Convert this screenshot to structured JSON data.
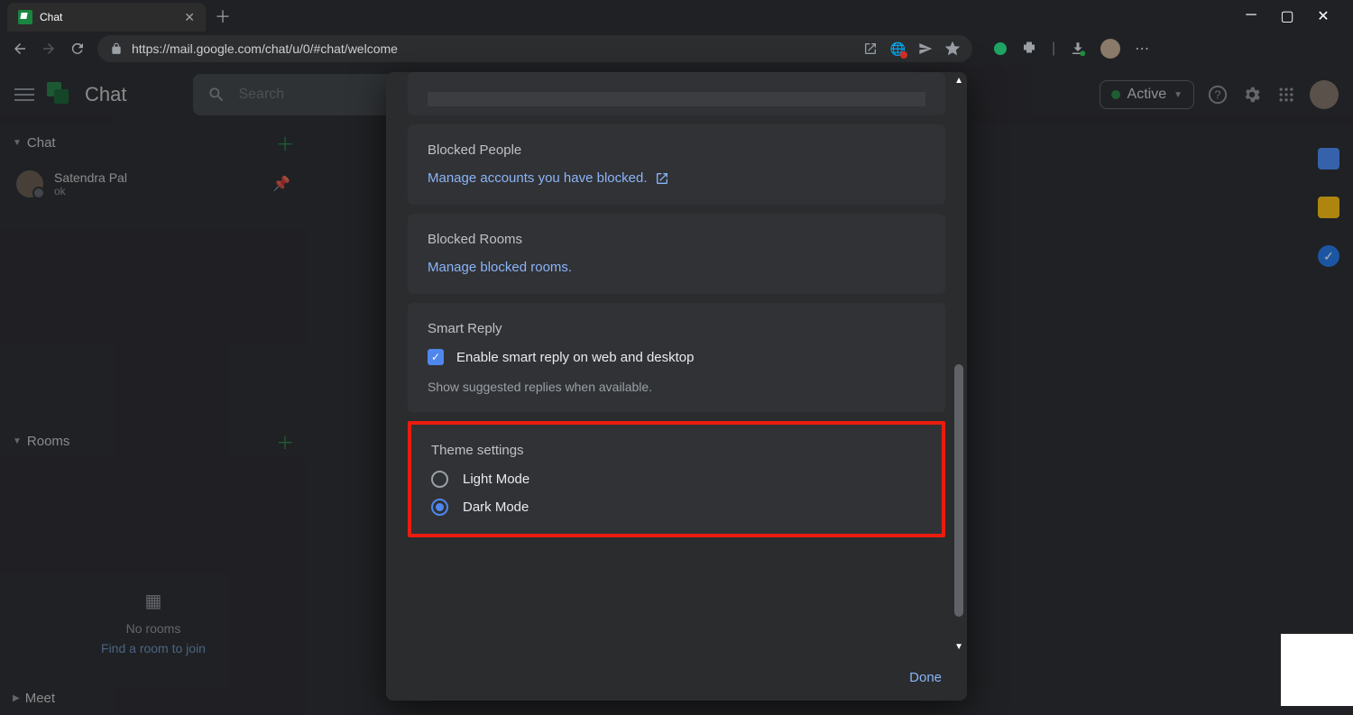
{
  "browser": {
    "tab_title": "Chat",
    "url": "https://mail.google.com/chat/u/0/#chat/welcome"
  },
  "app": {
    "title": "Chat",
    "search_placeholder": "Search",
    "status": "Active"
  },
  "sidebar": {
    "chat_section": "Chat",
    "rooms_section": "Rooms",
    "meet_section": "Meet",
    "contact": {
      "name": "Satendra Pal",
      "snippet": "ok"
    },
    "rooms_empty": {
      "title": "No rooms",
      "cta": "Find a room to join"
    }
  },
  "settings": {
    "blocked_people": {
      "title": "Blocked People",
      "link": "Manage accounts you have blocked."
    },
    "blocked_rooms": {
      "title": "Blocked Rooms",
      "link": "Manage blocked rooms."
    },
    "smart_reply": {
      "title": "Smart Reply",
      "checkbox": "Enable smart reply on web and desktop",
      "desc": "Show suggested replies when available."
    },
    "theme": {
      "title": "Theme settings",
      "light": "Light Mode",
      "dark": "Dark Mode"
    },
    "done": "Done"
  }
}
